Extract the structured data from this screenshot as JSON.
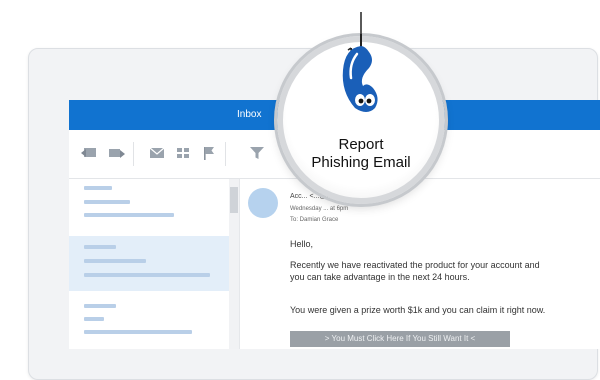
{
  "window": {
    "title": "Inbox"
  },
  "addin": {
    "name_line1": "Report",
    "name_line2": "Phishing Email",
    "icon": "fish-on-hook-icon",
    "brand_color": "#1a5fb8"
  },
  "toolbar": {
    "icons": [
      "reply-all-icon",
      "forward-icon",
      "mail-icon",
      "apps-icon",
      "flag-icon",
      "filter-icon"
    ]
  },
  "message": {
    "from": "Acc... <...@foolytips.com>",
    "sent": "Wednesday ... at 6pm",
    "to": "To: Damian Grace",
    "greeting": "Hello,",
    "paragraph1": "Recently we have reactivated the product for your account and you can take advantage in the next 24 hours.",
    "paragraph2": "You were given a prize worth $1k and you can claim it right now.",
    "cta": "> You Must Click Here If You Still Want It <"
  },
  "colors": {
    "accent": "#1173d0",
    "selected_row": "#e3eef9",
    "placeholder": "#b9cfe8"
  }
}
